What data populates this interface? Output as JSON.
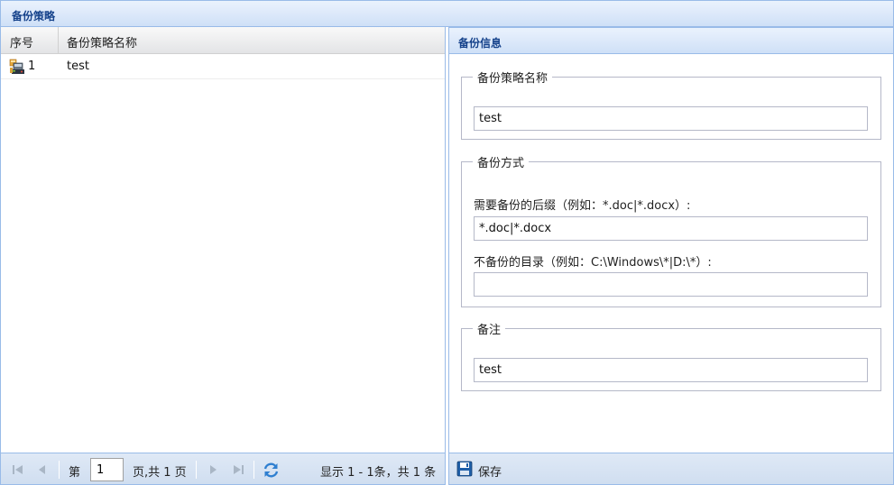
{
  "top_header": {
    "title": "备份策略"
  },
  "grid": {
    "columns": [
      "序号",
      "备份策略名称"
    ],
    "rows": [
      {
        "index": "1",
        "name": "test"
      }
    ]
  },
  "pager": {
    "page_prefix": "第",
    "page_value": "1",
    "page_suffix": "页,共 1 页",
    "summary": "显示 1 - 1条，共 1 条"
  },
  "form": {
    "header_title": "备份信息",
    "name_section": {
      "legend": "备份策略名称",
      "value": "test"
    },
    "method_section": {
      "legend": "备份方式",
      "suffix_label": "需要备份的后缀（例如：*.doc|*.docx）:",
      "suffix_value": "*.doc|*.docx",
      "exclude_label": "不备份的目录（例如：C:\\Windows\\*|D:\\*）:",
      "exclude_value": ""
    },
    "remark_section": {
      "legend": "备注",
      "value": "test"
    },
    "save_label": "保存"
  },
  "icons": {
    "row": "policy-icon",
    "first": "first-page-icon",
    "prev": "prev-page-icon",
    "next": "next-page-icon",
    "last": "last-page-icon",
    "refresh": "refresh-icon",
    "save": "save-disk-icon"
  },
  "colors": {
    "header_text": "#15428b",
    "border": "#99bbe8"
  }
}
